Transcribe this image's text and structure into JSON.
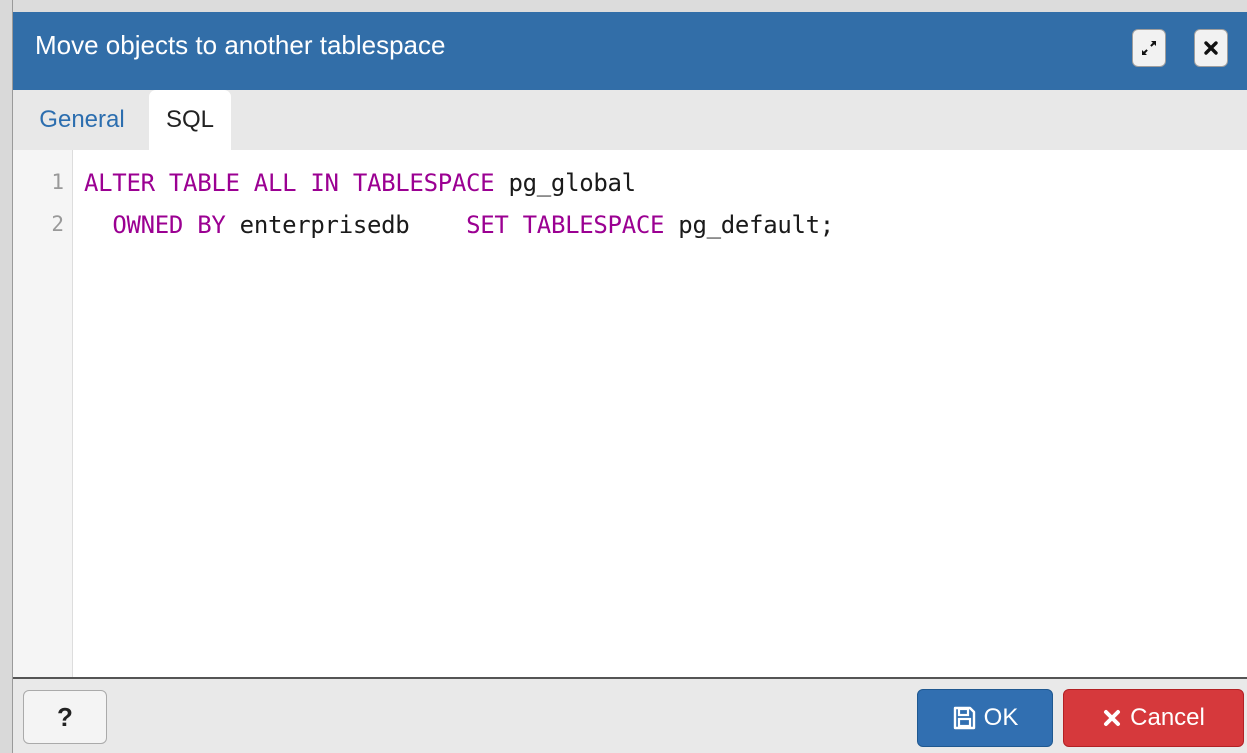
{
  "dialog": {
    "title": "Move objects to another tablespace"
  },
  "titlebar": {
    "maximize_icon": "expand-arrows-icon",
    "close_icon": "close-x-icon"
  },
  "tabs": [
    {
      "label": "General",
      "active": false
    },
    {
      "label": "SQL",
      "active": true
    }
  ],
  "editor": {
    "lines": [
      {
        "number": "1",
        "tokens": [
          {
            "text": "ALTER TABLE ALL IN TABLESPACE",
            "type": "keyword"
          },
          {
            "text": " pg_global",
            "type": "text"
          }
        ]
      },
      {
        "number": "2",
        "tokens": [
          {
            "text": "  ",
            "type": "text"
          },
          {
            "text": "OWNED BY",
            "type": "keyword"
          },
          {
            "text": " enterprisedb    ",
            "type": "text"
          },
          {
            "text": "SET TABLESPACE",
            "type": "keyword"
          },
          {
            "text": " pg_default;",
            "type": "text"
          }
        ]
      }
    ],
    "colors": {
      "keyword": "#9b0092",
      "text": "#1a1a1a"
    }
  },
  "footer": {
    "help_label": "?",
    "ok_label": "OK",
    "ok_icon": "floppy-disk-icon",
    "cancel_label": "Cancel",
    "cancel_icon": "close-x-icon"
  },
  "colors": {
    "titlebar": "#326ea8",
    "ok_button": "#316fb1",
    "cancel_button": "#d6393c",
    "tab_link": "#2c6eaf"
  }
}
